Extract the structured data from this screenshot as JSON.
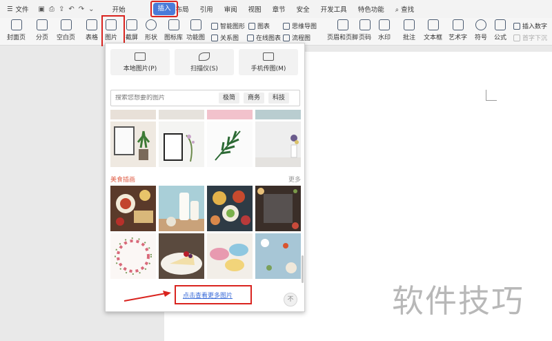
{
  "menubar": {
    "file_label": "文件",
    "tabs": [
      "开始",
      "插入",
      "页面布局",
      "引用",
      "审阅",
      "视图",
      "章节",
      "安全",
      "开发工具",
      "特色功能"
    ],
    "active_tab": "插入",
    "search_label": "查找"
  },
  "ribbon": {
    "cover": "封面页",
    "pagebreak": "分页",
    "blank": "空白页",
    "table": "表格",
    "picture": "图片",
    "screenshot": "截屏",
    "shape": "形状",
    "iconlib": "图标库",
    "funcmap": "功能图",
    "smartart": "智能图形",
    "chart": "图表",
    "relation": "关系图",
    "onlinechart": "在线图表",
    "mindmap": "思维导图",
    "flowchart": "流程图",
    "header_footer": "页眉和页脚",
    "pagenum": "页码",
    "watermark": "水印",
    "comment": "批注",
    "textbox": "文本框",
    "wordart": "艺术字",
    "symbol": "符号",
    "formula": "公式",
    "insert_number": "插入数字",
    "firstdrop": "首字下沉"
  },
  "panel": {
    "sources": [
      "本地图片(P)",
      "扫描仪(S)",
      "手机传图(M)"
    ],
    "search_placeholder": "搜索您想要的图片",
    "tags": [
      "极简",
      "商务",
      "科技"
    ],
    "section_title": "美食插画",
    "more_label": "更多",
    "view_more_link": "点击查看更多图片",
    "top_label": "不"
  },
  "watermark": "软件技巧"
}
